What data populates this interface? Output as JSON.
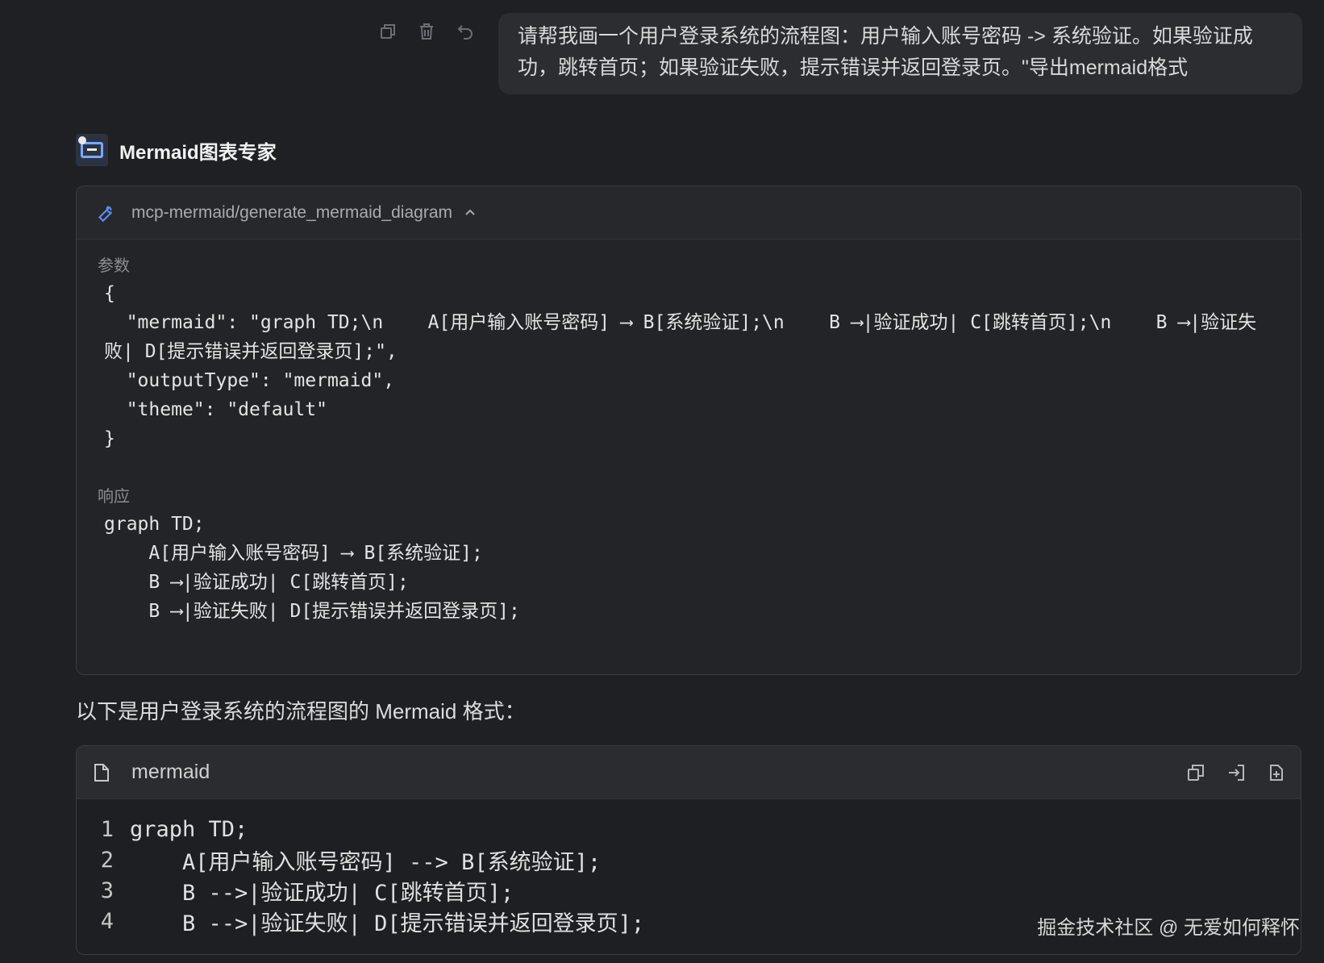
{
  "user_message": {
    "text": "请帮我画一个用户登录系统的流程图：用户输入账号密码 -> 系统验证。如果验证成功，跳转首页；如果验证失败，提示错误并返回登录页。\"导出mermaid格式"
  },
  "message_actions": {
    "copy_icon": "copy-icon",
    "delete_icon": "trash-icon",
    "undo_icon": "undo-icon"
  },
  "assistant": {
    "name": "Mermaid图表专家"
  },
  "tool_call": {
    "name": "mcp-mermaid/generate_mermaid_diagram",
    "params_label": "参数",
    "params_code": "{\n  \"mermaid\": \"graph TD;\\n    A[用户输入账号密码] ⟶ B[系统验证];\\n    B ⟶|验证成功| C[跳转首页];\\n    B ⟶|验证失败| D[提示错误并返回登录页];\",\n  \"outputType\": \"mermaid\",\n  \"theme\": \"default\"\n}",
    "response_label": "响应",
    "response_code": "graph TD;\n    A[用户输入账号密码] ⟶ B[系统验证];\n    B ⟶|验证成功| C[跳转首页];\n    B ⟶|验证失败| D[提示错误并返回登录页];"
  },
  "intro_text": "以下是用户登录系统的流程图的 Mermaid 格式：",
  "code_card": {
    "language": "mermaid",
    "lines": [
      {
        "num": "1",
        "text": "graph TD;"
      },
      {
        "num": "2",
        "text": "    A[用户输入账号密码] --> B[系统验证];"
      },
      {
        "num": "3",
        "text": "    B -->|验证成功| C[跳转首页];"
      },
      {
        "num": "4",
        "text": "    B -->|验证失败| D[提示错误并返回登录页];"
      }
    ]
  },
  "watermark": "掘金技术社区 @ 无爱如何释怀"
}
